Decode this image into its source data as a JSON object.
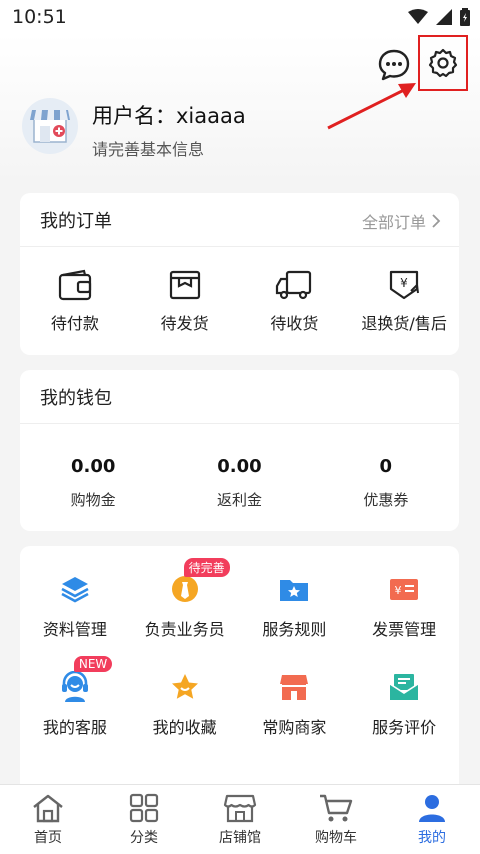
{
  "status_bar": {
    "time": "10:51"
  },
  "profile": {
    "username": "用户名：xiaaaa",
    "hint": "请完善基本信息"
  },
  "orders": {
    "title": "我的订单",
    "all_link": "全部订单",
    "items": [
      {
        "label": "待付款",
        "icon": "wallet-icon"
      },
      {
        "label": "待发货",
        "icon": "box-icon"
      },
      {
        "label": "待收货",
        "icon": "truck-icon"
      },
      {
        "label": "退换货/售后",
        "icon": "refund-icon"
      }
    ]
  },
  "wallet": {
    "title": "我的钱包",
    "items": [
      {
        "value": "0.00",
        "label": "购物金"
      },
      {
        "value": "0.00",
        "label": "返利金"
      },
      {
        "value": "0",
        "label": "优惠券"
      }
    ]
  },
  "services": {
    "items": [
      {
        "label": "资料管理",
        "icon": "layers-icon"
      },
      {
        "label": "负责业务员",
        "icon": "salesman-icon",
        "badge": "待完善"
      },
      {
        "label": "服务规则",
        "icon": "folder-star-icon"
      },
      {
        "label": "发票管理",
        "icon": "invoice-icon"
      },
      {
        "label": "我的客服",
        "icon": "headset-icon",
        "badge": "NEW"
      },
      {
        "label": "我的收藏",
        "icon": "star-icon"
      },
      {
        "label": "常购商家",
        "icon": "shop-icon"
      },
      {
        "label": "服务评价",
        "icon": "envelope-icon"
      }
    ]
  },
  "tabbar": {
    "items": [
      {
        "label": "首页",
        "icon": "home-icon"
      },
      {
        "label": "分类",
        "icon": "grid-icon"
      },
      {
        "label": "店铺馆",
        "icon": "store-icon"
      },
      {
        "label": "购物车",
        "icon": "cart-icon"
      },
      {
        "label": "我的",
        "icon": "user-icon",
        "active": true
      }
    ]
  },
  "colors": {
    "accent_blue": "#2c6de0",
    "highlight_red": "#e02020",
    "badge_pink": "#f23d5c",
    "icon_orange": "#f5a623",
    "icon_teal": "#2bb5a0"
  }
}
